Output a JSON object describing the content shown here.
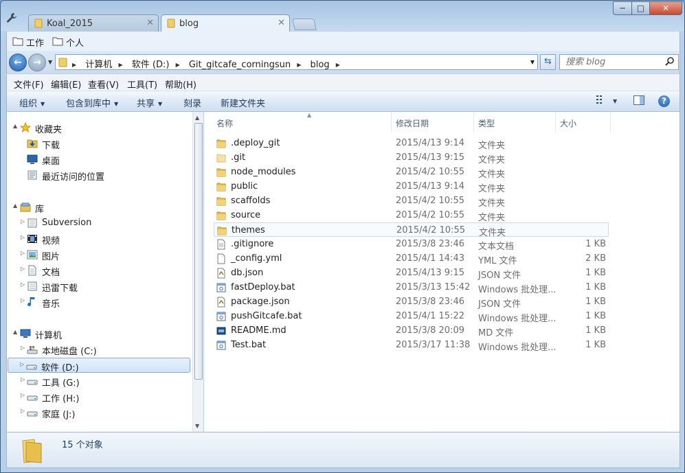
{
  "tabs": [
    {
      "label": "Koal_2015",
      "active": false
    },
    {
      "label": "blog",
      "active": true
    }
  ],
  "window_controls": {
    "minimize": "─",
    "maximize": "□",
    "close": "✕"
  },
  "favorites": [
    "工作",
    "个人"
  ],
  "address": {
    "crumbs": [
      "计算机",
      "软件 (D:)",
      "Git_gitcafe_corningsun",
      "blog"
    ],
    "search_placeholder": "搜索 blog"
  },
  "menu": [
    "文件(F)",
    "编辑(E)",
    "查看(V)",
    "工具(T)",
    "帮助(H)"
  ],
  "commands": [
    {
      "label": "组织",
      "dropdown": true
    },
    {
      "label": "包含到库中",
      "dropdown": true
    },
    {
      "label": "共享",
      "dropdown": true
    },
    {
      "label": "刻录",
      "dropdown": false
    },
    {
      "label": "新建文件夹",
      "dropdown": false
    }
  ],
  "help_label": "?",
  "tree": [
    {
      "label": "收藏夹",
      "icon": "star-icon",
      "level": 0,
      "expand": "▲"
    },
    {
      "label": "下载",
      "icon": "download-folder-icon",
      "level": 1
    },
    {
      "label": "桌面",
      "icon": "desktop-icon",
      "level": 1
    },
    {
      "label": "最近访问的位置",
      "icon": "recent-places-icon",
      "level": 1
    },
    {
      "label": "库",
      "icon": "library-icon",
      "level": 0,
      "expand": "▲"
    },
    {
      "label": "Subversion",
      "icon": "document-library-icon",
      "level": 1,
      "expand": "▷"
    },
    {
      "label": "视频",
      "icon": "video-library-icon",
      "level": 1,
      "expand": "▷"
    },
    {
      "label": "图片",
      "icon": "pictures-library-icon",
      "level": 1,
      "expand": "▷"
    },
    {
      "label": "文档",
      "icon": "documents-library-icon",
      "level": 1,
      "expand": "▷"
    },
    {
      "label": "迅雷下载",
      "icon": "document-library-icon",
      "level": 1,
      "expand": "▷"
    },
    {
      "label": "音乐",
      "icon": "music-library-icon",
      "level": 1,
      "expand": "▷"
    },
    {
      "label": "计算机",
      "icon": "computer-icon",
      "level": 0,
      "expand": "▲"
    },
    {
      "label": "本地磁盘 (C:)",
      "icon": "system-drive-icon",
      "level": 1,
      "expand": "▷"
    },
    {
      "label": "软件 (D:)",
      "icon": "drive-icon",
      "level": 1,
      "expand": "▷",
      "selected": true
    },
    {
      "label": "工具 (G:)",
      "icon": "drive-icon",
      "level": 1,
      "expand": "▷"
    },
    {
      "label": "工作 (H:)",
      "icon": "drive-icon",
      "level": 1,
      "expand": "▷"
    },
    {
      "label": "家庭 (J:)",
      "icon": "drive-icon",
      "level": 1,
      "expand": "▷"
    }
  ],
  "columns": {
    "name": "名称",
    "date": "修改日期",
    "type": "类型",
    "size": "大小"
  },
  "files": [
    {
      "name": ".deploy_git",
      "date": "2015/4/13 9:14",
      "type": "文件夹",
      "size": "",
      "icon": "folder-icon"
    },
    {
      "name": ".git",
      "date": "2015/4/13 9:15",
      "type": "文件夹",
      "size": "",
      "icon": "folder-hidden-icon"
    },
    {
      "name": "node_modules",
      "date": "2015/4/2 10:55",
      "type": "文件夹",
      "size": "",
      "icon": "folder-icon"
    },
    {
      "name": "public",
      "date": "2015/4/13 9:14",
      "type": "文件夹",
      "size": "",
      "icon": "folder-icon"
    },
    {
      "name": "scaffolds",
      "date": "2015/4/2 10:55",
      "type": "文件夹",
      "size": "",
      "icon": "folder-icon"
    },
    {
      "name": "source",
      "date": "2015/4/2 10:55",
      "type": "文件夹",
      "size": "",
      "icon": "folder-icon"
    },
    {
      "name": "themes",
      "date": "2015/4/2 10:55",
      "type": "文件夹",
      "size": "",
      "icon": "folder-icon",
      "hover": true
    },
    {
      "name": ".gitignore",
      "date": "2015/3/8 23:46",
      "type": "文本文档",
      "size": "1 KB",
      "icon": "text-file-icon"
    },
    {
      "name": "_config.yml",
      "date": "2015/4/1 14:43",
      "type": "YML 文件",
      "size": "2 KB",
      "icon": "blank-file-icon"
    },
    {
      "name": "db.json",
      "date": "2015/4/13 9:15",
      "type": "JSON 文件",
      "size": "1 KB",
      "icon": "json-file-icon"
    },
    {
      "name": "fastDeploy.bat",
      "date": "2015/3/13 15:42",
      "type": "Windows 批处理...",
      "size": "1 KB",
      "icon": "batch-file-icon"
    },
    {
      "name": "package.json",
      "date": "2015/3/8 23:46",
      "type": "JSON 文件",
      "size": "1 KB",
      "icon": "json-file-icon"
    },
    {
      "name": "pushGitcafe.bat",
      "date": "2015/4/1 15:22",
      "type": "Windows 批处理...",
      "size": "1 KB",
      "icon": "batch-file-icon"
    },
    {
      "name": "README.md",
      "date": "2015/3/8 20:09",
      "type": "MD 文件",
      "size": "1 KB",
      "icon": "markdown-file-icon"
    },
    {
      "name": "Test.bat",
      "date": "2015/3/17 11:38",
      "type": "Windows 批处理...",
      "size": "1 KB",
      "icon": "batch-file-icon"
    }
  ],
  "status": {
    "count": "15 个对象"
  },
  "colors": {
    "selection_border": "#84acdd",
    "folder": "#e8c25a",
    "accent": "#1f5ba8"
  }
}
